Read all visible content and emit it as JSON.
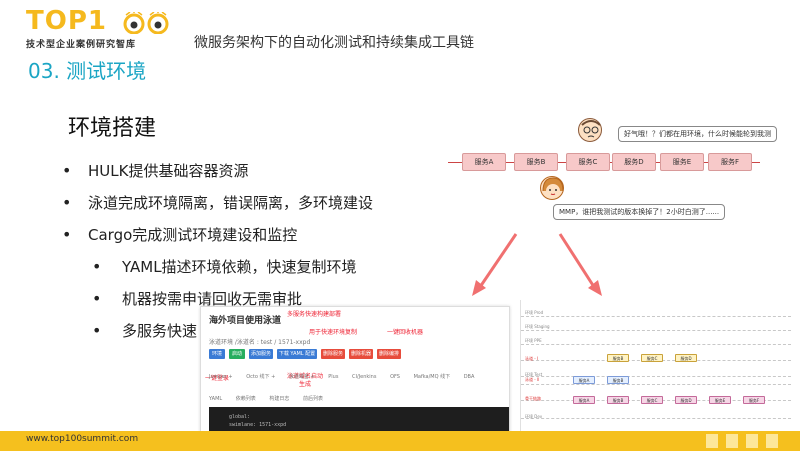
{
  "header": {
    "logo_text": "TOP1",
    "logo_sub": "技术型企业案例研究智库",
    "title": "微服务架构下的自动化测试和持续集成工具链",
    "section": "03. 测试环境"
  },
  "main": {
    "heading": "环境搭建",
    "bullets": [
      {
        "text": "HULK提供基础容器资源",
        "level": 1
      },
      {
        "text": "泳道完成环境隔离，错误隔离，多环境建设",
        "level": 1
      },
      {
        "text": "Cargo完成测试环境建设和监控",
        "level": 1
      },
      {
        "text": "YAML描述环境依赖，快速复制环境",
        "level": 2
      },
      {
        "text": "机器按需申请回收无需审批",
        "level": 2
      },
      {
        "text": "多服务快速",
        "level": 2
      }
    ]
  },
  "flow": {
    "services": [
      "服务A",
      "服务B",
      "服务C",
      "服务D",
      "服务E",
      "服务F"
    ],
    "bubble_top": "好气哦！？们都在用环境，什么时候能轮到我测",
    "bubble_bottom": "MMP，谁把我测试的版本换掉了！2小时白测了......"
  },
  "panel": {
    "title": "海外项目使用泳道",
    "subtitle": "泳道环境 /泳道名 : test / 1571-xxpd",
    "buttons": [
      {
        "label": "环境",
        "color": "#3a7bd5"
      },
      {
        "label": "启动",
        "color": "#27ae60"
      },
      {
        "label": "添加服务",
        "color": "#3a7bd5"
      },
      {
        "label": "下载 YAML 配置",
        "color": "#3a7bd5"
      },
      {
        "label": "删除服务",
        "color": "#e74c3c"
      },
      {
        "label": "删除机器",
        "color": "#e74c3c"
      },
      {
        "label": "删除编排",
        "color": "#e74c3c"
      }
    ],
    "notes": {
      "n1": "多服务快速构建部署",
      "n2": "用于快速环境复制",
      "n3": "一键回收机器",
      "n4": "一键登录",
      "n5": "泳道域名启动",
      "n5b": "生成"
    },
    "tabs": [
      "Jumper +",
      "Octo 线下 +",
      "泳道域名 +",
      "Plus",
      "CI/Jenkins",
      "OFS",
      "Mafka/MQ 线下",
      "DBA"
    ],
    "tabs2": [
      "YAML",
      "依赖列表",
      "构建日志",
      "前后列表"
    ],
    "code": [
      "global:",
      "  swimlane: 1571-xxpd"
    ]
  },
  "panel2": {
    "lanes": [
      {
        "label": "环境 Prod",
        "red": false
      },
      {
        "label": "环境 Staging",
        "red": false
      },
      {
        "label": "环境 PPE",
        "red": false
      },
      {
        "label": "泳道 - I",
        "red": true
      },
      {
        "label": "环境 Test",
        "red": false
      },
      {
        "label": "泳道 - II",
        "red": true
      },
      {
        "label": "骨干链路",
        "red": true
      },
      {
        "label": "环境 Dev",
        "red": false
      }
    ],
    "boxes": {
      "b": "服务B",
      "c": "服务C",
      "d": "服务D",
      "a": "服务A",
      "e": "服务E",
      "f": "服务F"
    }
  },
  "footer": {
    "url": "www.top100summit.com"
  },
  "colors": {
    "accent": "#1aa5c4",
    "footer": "#f5c01e",
    "logo": "#f5b91e",
    "arrow": "#f07070"
  }
}
